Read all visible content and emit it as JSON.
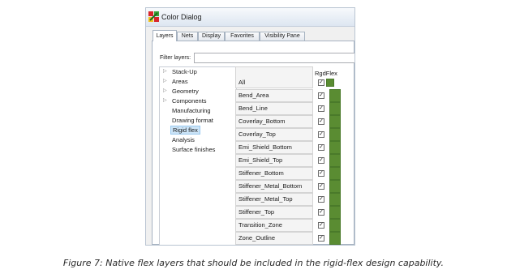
{
  "window": {
    "title": "Color Dialog",
    "icon": "color-palette-icon"
  },
  "tabs": [
    {
      "label": "Layers",
      "active": true
    },
    {
      "label": "Nets",
      "active": false
    },
    {
      "label": "Display",
      "active": false
    },
    {
      "label": "Favorites",
      "active": false
    },
    {
      "label": "Visibility Pane",
      "active": false
    }
  ],
  "filter": {
    "label": "Filter layers:",
    "value": ""
  },
  "tree": {
    "items": [
      {
        "label": "Stack-Up",
        "expandable": true,
        "selected": false
      },
      {
        "label": "Areas",
        "expandable": true,
        "selected": false
      },
      {
        "label": "Geometry",
        "expandable": true,
        "selected": false
      },
      {
        "label": "Components",
        "expandable": true,
        "selected": false
      },
      {
        "label": "Manufacturing",
        "expandable": false,
        "selected": false
      },
      {
        "label": "Drawing format",
        "expandable": false,
        "selected": false
      },
      {
        "label": "Rigid flex",
        "expandable": false,
        "selected": true
      },
      {
        "label": "Analysis",
        "expandable": false,
        "selected": false
      },
      {
        "label": "Surface finishes",
        "expandable": false,
        "selected": false
      }
    ]
  },
  "grid": {
    "column_header": "RgdFlex",
    "all_label": "All",
    "all_checked": true,
    "swatch_color": "#5a8c32",
    "rows": [
      {
        "name": "Bend_Area",
        "checked": true
      },
      {
        "name": "Bend_Line",
        "checked": true
      },
      {
        "name": "Coverlay_Bottom",
        "checked": true
      },
      {
        "name": "Coverlay_Top",
        "checked": true
      },
      {
        "name": "Emi_Shield_Bottom",
        "checked": true
      },
      {
        "name": "Emi_Shield_Top",
        "checked": true
      },
      {
        "name": "Stiffener_Bottom",
        "checked": true
      },
      {
        "name": "Stiffener_Metal_Bottom",
        "checked": true
      },
      {
        "name": "Stiffener_Metal_Top",
        "checked": true
      },
      {
        "name": "Stiffener_Top",
        "checked": true
      },
      {
        "name": "Transition_Zone",
        "checked": true
      },
      {
        "name": "Zone_Outline",
        "checked": true
      }
    ]
  },
  "caption": "Figure 7: Native flex layers that should be included in the rigid-flex design capability."
}
